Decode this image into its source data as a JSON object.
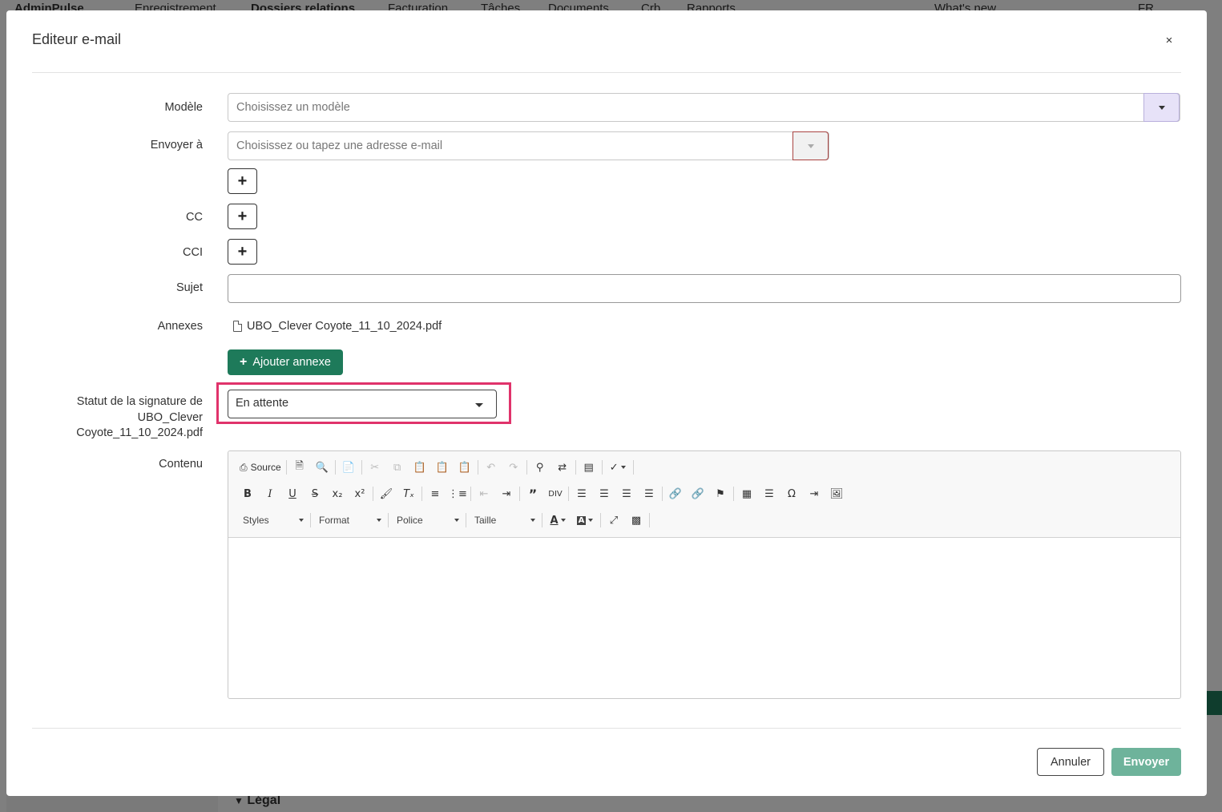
{
  "background": {
    "nav_items": [
      "AdminPulse",
      "Enregistrement",
      "Dossiers relations",
      "Facturation",
      "Tâches",
      "Documents",
      "Crb",
      "Rapports",
      "What's new",
      "FR"
    ],
    "legal_label": "Légal"
  },
  "modal": {
    "title": "Editeur e-mail",
    "close_symbol": "×"
  },
  "form": {
    "template_label": "Modèle",
    "template_placeholder": "Choisissez un modèle",
    "send_to_label": "Envoyer à",
    "send_to_placeholder": "Choisissez ou tapez une adresse e-mail",
    "plus_symbol": "+",
    "cc_label": "CC",
    "bcc_label": "CCI",
    "subject_label": "Sujet",
    "subject_value": "",
    "attachments_label": "Annexes",
    "attachment_file": "UBO_Clever Coyote_11_10_2024.pdf",
    "add_attachment_label": "Ajouter annexe",
    "signature_status_label": "Statut de la signature de UBO_Clever Coyote_11_10_2024.pdf",
    "signature_status_value": "En attente",
    "content_label": "Contenu"
  },
  "editor": {
    "source_label": "Source",
    "combos": [
      "Styles",
      "Format",
      "Police",
      "Taille"
    ],
    "icons_row1": [
      "source-icon",
      "save-icon",
      "preview-icon",
      "templates-icon",
      "cut-icon",
      "copy-icon",
      "paste-icon",
      "paste-text-icon",
      "paste-word-icon",
      "undo-icon",
      "redo-icon",
      "find-icon",
      "replace-icon",
      "select-all-icon",
      "spellcheck-icon"
    ],
    "icons_row2": [
      "bold-icon",
      "italic-icon",
      "underline-icon",
      "strike-icon",
      "subscript-icon",
      "superscript-icon",
      "copy-format-icon",
      "remove-format-icon",
      "numbered-list-icon",
      "bulleted-list-icon",
      "outdent-icon",
      "indent-icon",
      "blockquote-icon",
      "creatediv-icon",
      "align-left-icon",
      "align-center-icon",
      "align-right-icon",
      "justify-icon",
      "link-icon",
      "unlink-icon",
      "anchor-icon",
      "table-icon",
      "horizontal-rule-icon",
      "special-char-icon",
      "page-break-icon",
      "image-icon"
    ],
    "icons_row3": [
      "text-color-icon",
      "bg-color-icon",
      "maximize-icon",
      "show-blocks-icon"
    ]
  },
  "footer": {
    "cancel_label": "Annuler",
    "send_label": "Envoyer"
  },
  "colors": {
    "primary_green": "#1e7a5a",
    "send_disabled": "#6eb39b",
    "highlight": "#e0336b",
    "select_purple": "#e7e2f8",
    "error_border": "#a94442"
  }
}
